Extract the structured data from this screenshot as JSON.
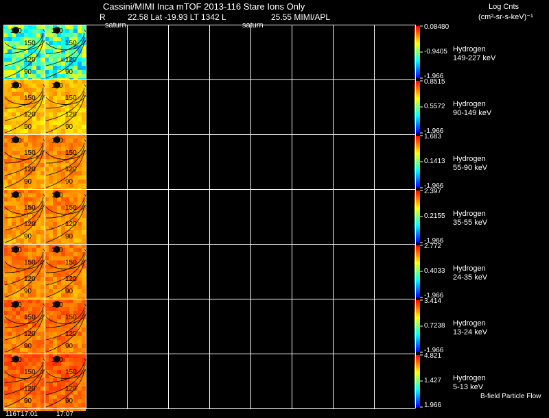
{
  "header": {
    "title": "Cassini/MIMI Inca mTOF  2013-116   Stare   Ions Only",
    "r_label": "R",
    "ephemeris": "22.58 Lat -19.93 LT 1342 L",
    "instrument": "25.55  MIMI/APL",
    "units_title": "Log Cnts",
    "units_sub": "(cm²-sr-s-keV)⁻¹",
    "cell_label_1": "saturn",
    "cell_label_2": "saturn"
  },
  "footer": {
    "bfield_label": "B-field Particle Flow",
    "time_1": "116T17:01",
    "time_2": "17:07"
  },
  "colors": {
    "background": "#000000",
    "grid": "#ffffff",
    "colormap": [
      "#0000ff",
      "#0080ff",
      "#00ffff",
      "#80ff80",
      "#ffff00",
      "#ff8000",
      "#ff0000"
    ]
  },
  "chart_data": {
    "type": "heatmap",
    "title": "Cassini/MIMI Inca mTOF  2013-116   Stare   Ions Only",
    "ring_labels": [
      "180",
      "150",
      "120",
      "90"
    ],
    "bands": [
      {
        "species": "Hydrogen",
        "energy": "149-227 keV",
        "cbar_max": "0.08480",
        "cbar_mid": "-0.9405",
        "cbar_min": "-1.966",
        "level": 0.55
      },
      {
        "species": "Hydrogen",
        "energy": "90-149 keV",
        "cbar_max": "0.8515",
        "cbar_mid": "0.5572",
        "cbar_min": "-1.966",
        "level": 0.78
      },
      {
        "species": "Hydrogen",
        "energy": "55-90 keV",
        "cbar_max": "1.683",
        "cbar_mid": "0.1413",
        "cbar_min": "-1.966",
        "level": 0.84
      },
      {
        "species": "Hydrogen",
        "energy": "35-55 keV",
        "cbar_max": "2.397",
        "cbar_mid": "0.2155",
        "cbar_min": "-1.966",
        "level": 0.84
      },
      {
        "species": "Hydrogen",
        "energy": "24-35 keV",
        "cbar_max": "2.772",
        "cbar_mid": "0.4033",
        "cbar_min": "-1.966",
        "level": 0.86
      },
      {
        "species": "Hydrogen",
        "energy": "13-24 keV",
        "cbar_max": "3.414",
        "cbar_mid": "0.7238",
        "cbar_min": "-1.966",
        "level": 0.88
      },
      {
        "species": "Hydrogen",
        "energy": "5-13 keV",
        "cbar_max": "4.821",
        "cbar_mid": "1.427",
        "cbar_min": "1.966",
        "level": 0.9
      }
    ],
    "time_columns": [
      "116T17:01",
      "17:07"
    ],
    "empty_columns": 8
  }
}
